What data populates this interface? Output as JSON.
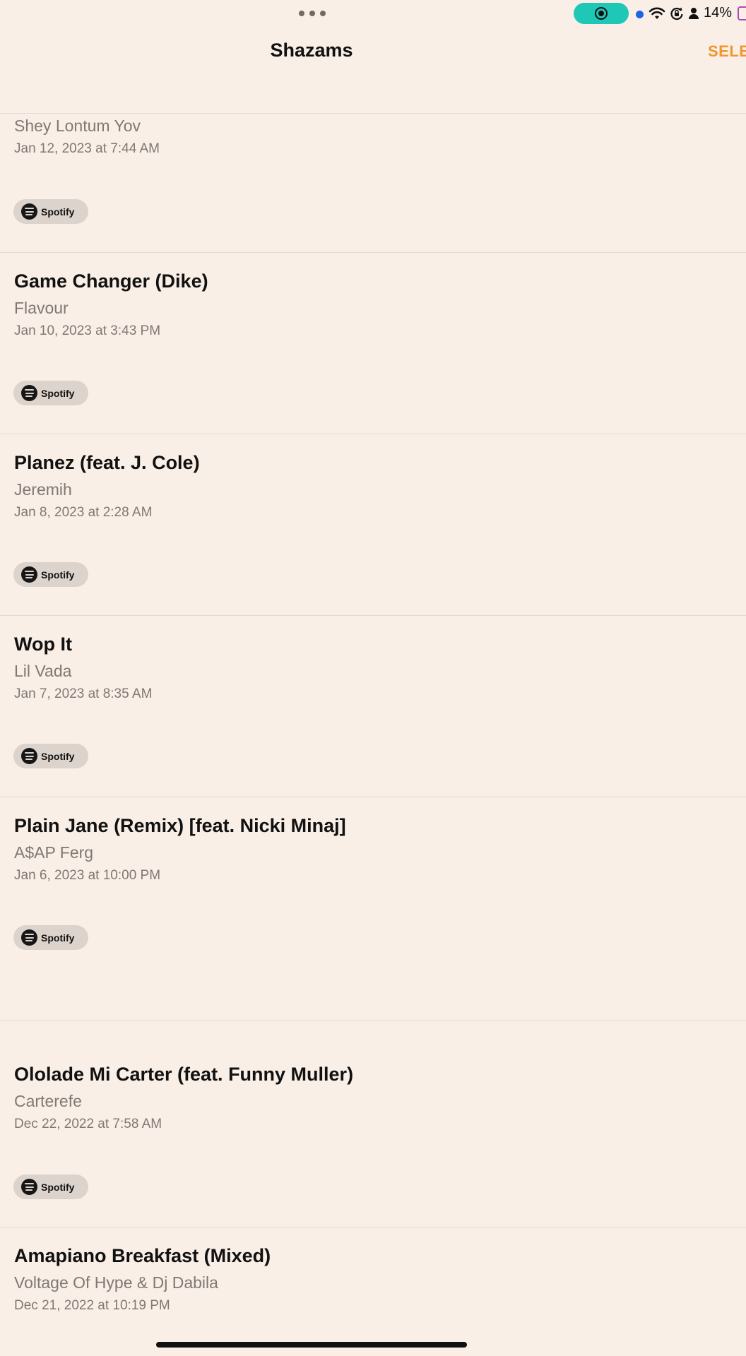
{
  "status_bar": {
    "battery_text": "14%",
    "icons": [
      "more-dots-icon",
      "screen-record-icon",
      "camera-indicator-icon",
      "wifi-icon",
      "rotation-lock-icon",
      "person-icon",
      "battery-icon"
    ],
    "record_color": "#1fc7b7"
  },
  "nav": {
    "title": "Shazams",
    "select_label": "SELE",
    "accent_color": "#f0962c"
  },
  "items": [
    {
      "title": "",
      "artist": "Shey Lontum Yov",
      "date": "Jan 12, 2023 at 7:44 AM",
      "button": "Spotify"
    },
    {
      "title": "Game Changer (Dike)",
      "artist": "Flavour",
      "date": "Jan 10, 2023 at 3:43 PM",
      "button": "Spotify"
    },
    {
      "title": "Planez (feat. J. Cole)",
      "artist": "Jeremih",
      "date": "Jan 8, 2023 at 2:28 AM",
      "button": "Spotify"
    },
    {
      "title": "Wop It",
      "artist": "Lil Vada",
      "date": "Jan 7, 2023 at 8:35 AM",
      "button": "Spotify"
    },
    {
      "title": "Plain Jane (Remix) [feat. Nicki Minaj]",
      "artist": "A$AP Ferg",
      "date": "Jan 6, 2023 at 10:00 PM",
      "button": "Spotify"
    },
    {
      "title": "Ololade Mi Carter (feat. Funny Muller)",
      "artist": "Carterefe",
      "date": "Dec 22, 2022 at 7:58 AM",
      "button": "Spotify"
    },
    {
      "title": "Amapiano Breakfast (Mixed)",
      "artist": "Voltage Of Hype & Dj Dabila",
      "date": "Dec 21, 2022 at 10:19 PM",
      "button": ""
    }
  ]
}
